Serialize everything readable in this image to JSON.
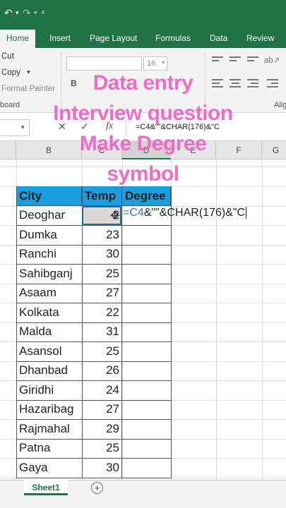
{
  "tabs": [
    "Home",
    "Insert",
    "Page Layout",
    "Formulas",
    "Data",
    "Review"
  ],
  "ribbon": {
    "cut": "Cut",
    "copy": "Copy",
    "copy_arrow": "▾",
    "format_painter": "Format Painter",
    "clipboard_group": "board",
    "font_size": "16",
    "bold": "B",
    "align_group": "Alig"
  },
  "formula_bar": {
    "name_arrow": "▾",
    "cancel": "✕",
    "enter": "✓",
    "fx": "fx",
    "formula": "=C4&\"\"&CHAR(176)&\"C"
  },
  "columns": [
    "B",
    "C",
    "D",
    "E",
    "F",
    "G"
  ],
  "table": {
    "headers": [
      "City",
      "Temp",
      "Degree"
    ],
    "rows": [
      {
        "city": "Deoghar",
        "temp": "2"
      },
      {
        "city": "Dumka",
        "temp": "23"
      },
      {
        "city": "Ranchi",
        "temp": "30"
      },
      {
        "city": "Sahibganj",
        "temp": "25"
      },
      {
        "city": "Asaam",
        "temp": "27"
      },
      {
        "city": "Kolkata",
        "temp": "22"
      },
      {
        "city": "Malda",
        "temp": "31"
      },
      {
        "city": "Asansol",
        "temp": "25"
      },
      {
        "city": "Dhanbad",
        "temp": "26"
      },
      {
        "city": "Giridhi",
        "temp": "24"
      },
      {
        "city": "Hazaribag",
        "temp": "27"
      },
      {
        "city": "Rajmahal",
        "temp": "29"
      },
      {
        "city": "Patna",
        "temp": "25"
      },
      {
        "city": "Gaya",
        "temp": "30"
      }
    ]
  },
  "edit_cell": {
    "ref": "=C4",
    "rest": "&\"\"&CHAR(176)&\"C"
  },
  "sheet_tab": "Sheet1",
  "add_sheet": "+",
  "caption": [
    "Data entry",
    "Interview question",
    "Make Degree",
    "symbol"
  ],
  "colors": {
    "excel_green": "#217346",
    "header_blue": "#1a9ee0",
    "caption_pink": "#f06bc8"
  }
}
